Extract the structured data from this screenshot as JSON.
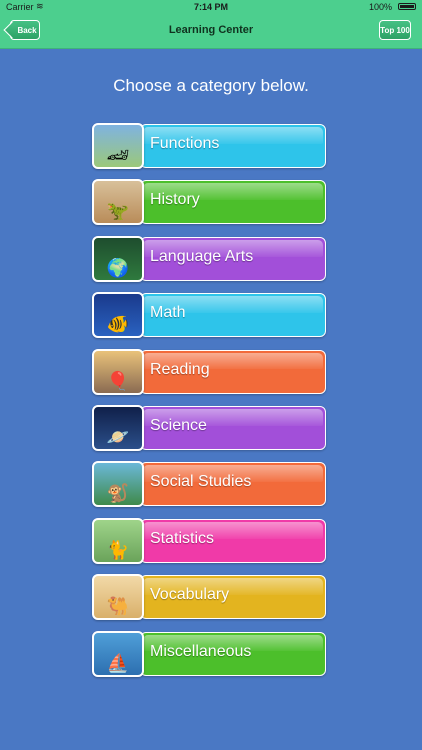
{
  "status_bar": {
    "carrier": "Carrier",
    "time": "7:14 PM",
    "battery": "100%"
  },
  "nav": {
    "back_label": "Back",
    "title": "Learning Center",
    "top_label": "Top 100"
  },
  "heading": "Choose a category below.",
  "categories": [
    {
      "label": "Functions",
      "color": "#2ec4ea",
      "icon": "race-car-icon",
      "thumb": [
        "#7fb3e0",
        "#9bc87a"
      ],
      "glyph": "🏎"
    },
    {
      "label": "History",
      "color": "#4cbf2b",
      "icon": "dinosaur-icon",
      "thumb": [
        "#d8c09a",
        "#b98c59"
      ],
      "glyph": "🦖"
    },
    {
      "label": "Language Arts",
      "color": "#a24fd9",
      "icon": "globe-icon",
      "thumb": [
        "#1e4d2e",
        "#2f7a3e"
      ],
      "glyph": "🌍"
    },
    {
      "label": "Math",
      "color": "#2ec4ea",
      "icon": "fish-icon",
      "thumb": [
        "#1a3a8c",
        "#2a62c0"
      ],
      "glyph": "🐠"
    },
    {
      "label": "Reading",
      "color": "#f26a3a",
      "icon": "hot-air-balloon-icon",
      "thumb": [
        "#e9c27a",
        "#8a6b52"
      ],
      "glyph": "🎈"
    },
    {
      "label": "Science",
      "color": "#a24fd9",
      "icon": "planets-icon",
      "thumb": [
        "#10204a",
        "#2b4f8a"
      ],
      "glyph": "🪐"
    },
    {
      "label": "Social Studies",
      "color": "#f26a3a",
      "icon": "monkey-icon",
      "thumb": [
        "#6bb8d8",
        "#3f8a4a"
      ],
      "glyph": "🐒"
    },
    {
      "label": "Statistics",
      "color": "#f03aa8",
      "icon": "cat-fence-icon",
      "thumb": [
        "#9fd48a",
        "#6aa35a"
      ],
      "glyph": "🐈"
    },
    {
      "label": "Vocabulary",
      "color": "#e3b41f",
      "icon": "camel-desert-icon",
      "thumb": [
        "#f2d9a8",
        "#d9b06a"
      ],
      "glyph": "🐫"
    },
    {
      "label": "Miscellaneous",
      "color": "#4cbf2b",
      "icon": "ship-icon",
      "thumb": [
        "#4f9fd8",
        "#2d6fb0"
      ],
      "glyph": "⛵"
    }
  ]
}
